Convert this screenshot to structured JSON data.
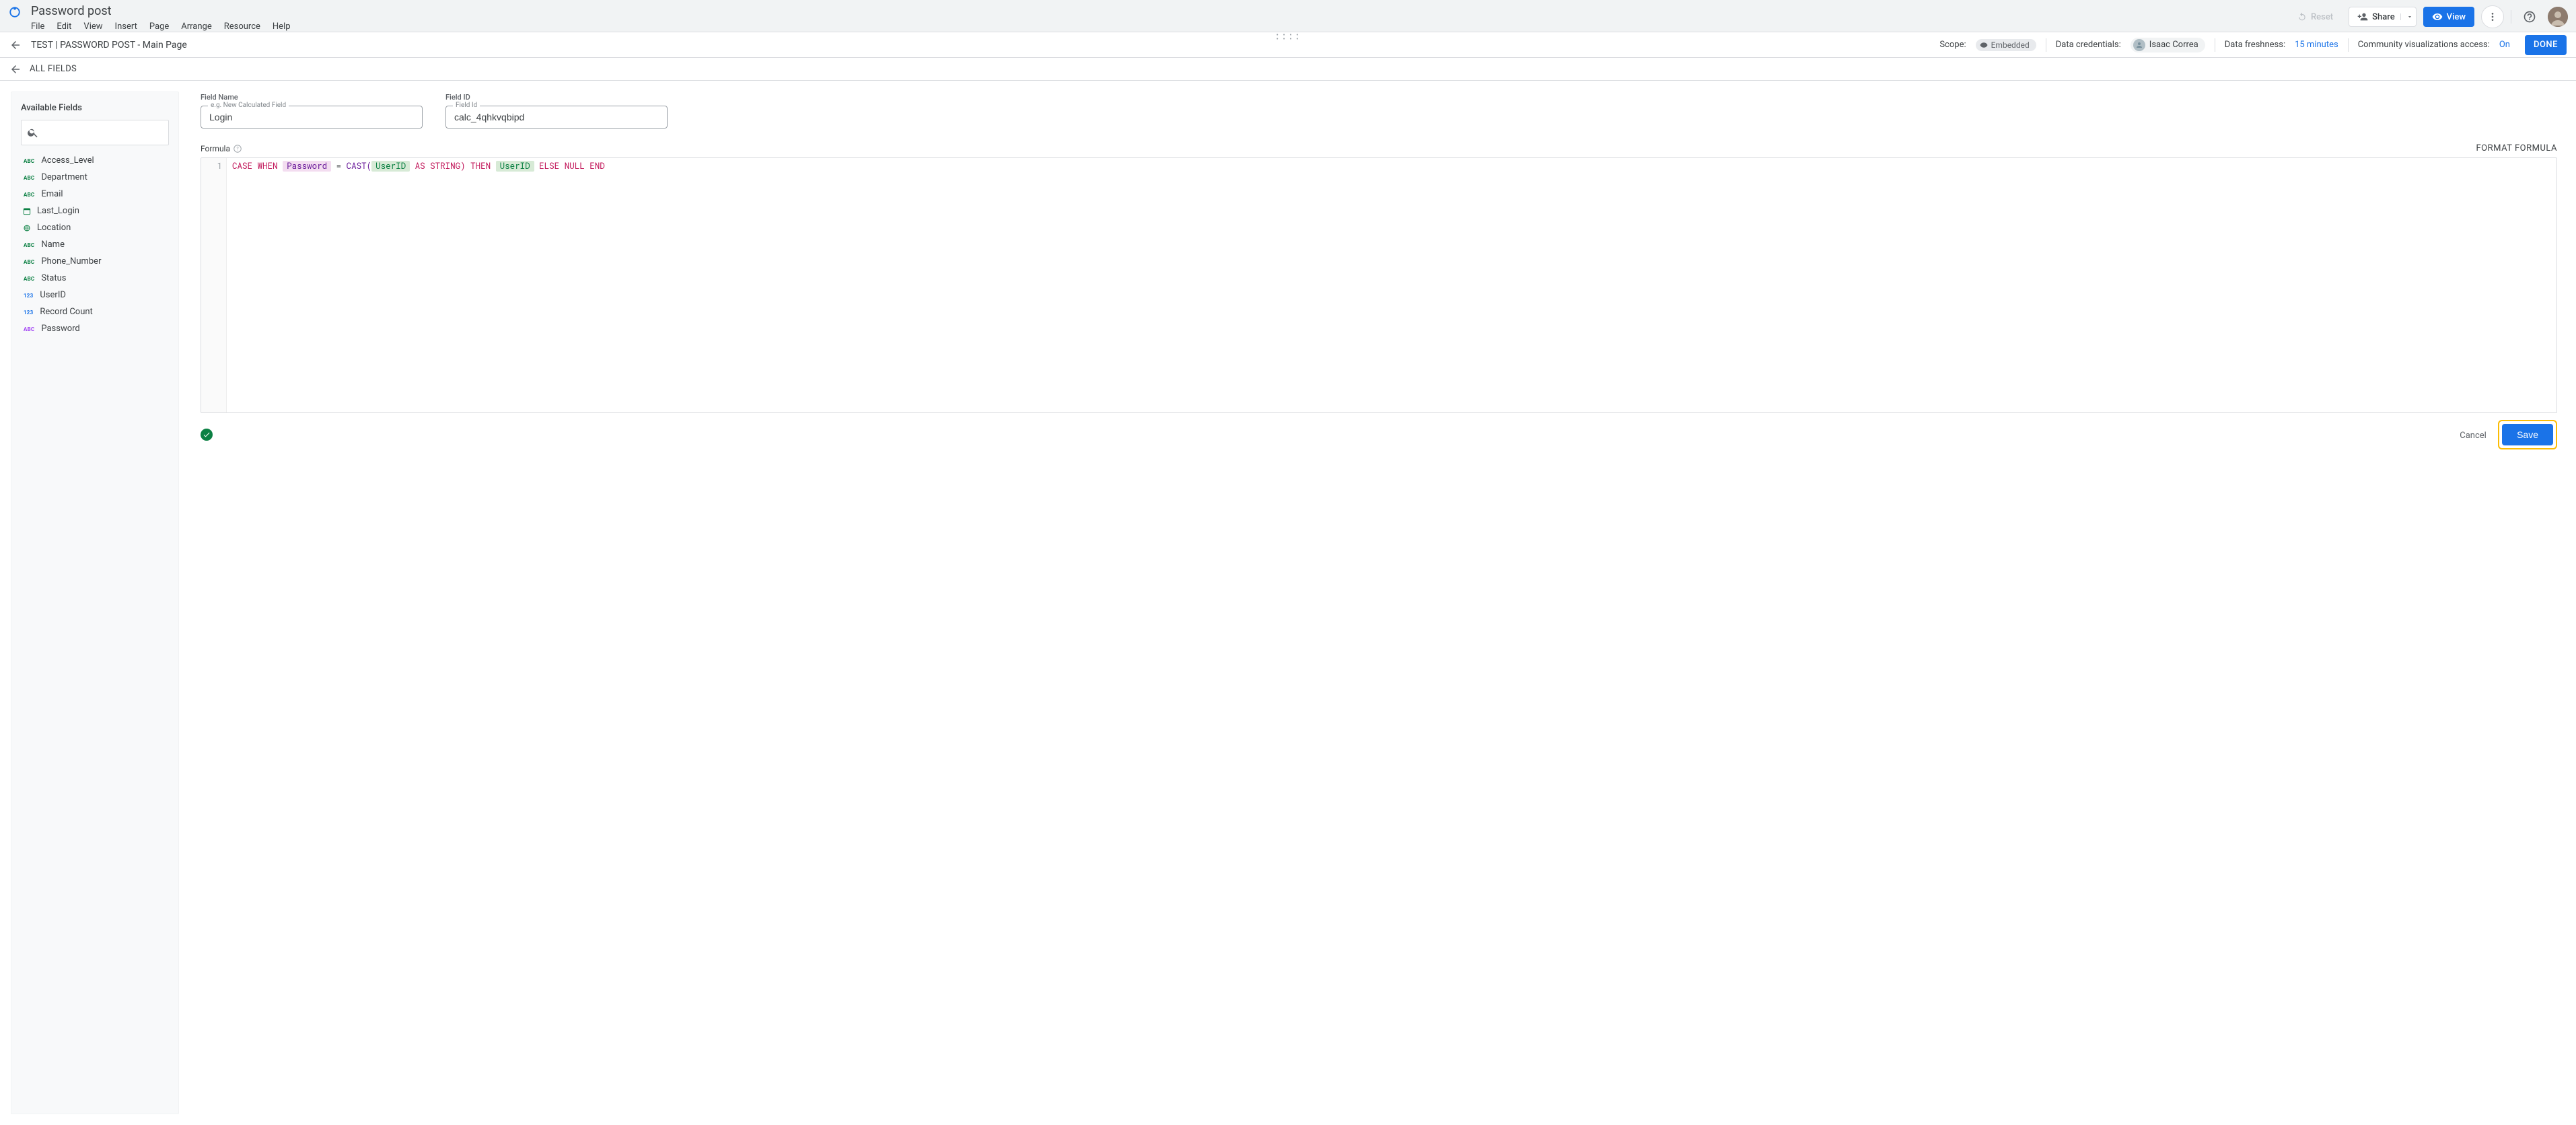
{
  "app": {
    "doc_title": "Password post",
    "menus": [
      "File",
      "Edit",
      "View",
      "Insert",
      "Page",
      "Arrange",
      "Resource",
      "Help"
    ]
  },
  "top_actions": {
    "reset": "Reset",
    "share": "Share",
    "view": "View",
    "done": "DONE"
  },
  "page_bar": {
    "title": "TEST | PASSWORD POST - Main Page",
    "scope_label": "Scope:",
    "scope_value": "Embedded",
    "creds_label": "Data credentials:",
    "creds_user": "Isaac Correa",
    "freshness_label": "Data freshness:",
    "freshness_value": "15 minutes",
    "viz_label": "Community visualizations access:",
    "viz_value": "On"
  },
  "fields_bar": {
    "all_fields": "ALL FIELDS"
  },
  "sidebar": {
    "title": "Available Fields",
    "search_placeholder": "",
    "fields": [
      {
        "name": "Access_Level",
        "type": "abc-g"
      },
      {
        "name": "Department",
        "type": "abc-g"
      },
      {
        "name": "Email",
        "type": "abc-g"
      },
      {
        "name": "Last_Login",
        "type": "date"
      },
      {
        "name": "Location",
        "type": "geo"
      },
      {
        "name": "Name",
        "type": "abc-g"
      },
      {
        "name": "Phone_Number",
        "type": "abc-g"
      },
      {
        "name": "Status",
        "type": "abc-g"
      },
      {
        "name": "UserID",
        "type": "num"
      },
      {
        "name": "Record Count",
        "type": "num"
      },
      {
        "name": "Password",
        "type": "abc-p"
      }
    ]
  },
  "editor": {
    "field_name_label": "Field Name",
    "field_name_float": "e.g. New Calculated Field",
    "field_name_value": "Login",
    "field_id_label": "Field ID",
    "field_id_float": "Field Id",
    "field_id_value": "calc_4qhkvqbipd",
    "formula_label": "Formula",
    "format_btn": "FORMAT FORMULA",
    "line_no": "1",
    "tokens": {
      "case": "CASE",
      "when": "WHEN",
      "password": "Password",
      "eq": " = ",
      "cast_open": "CAST(",
      "userid1": "UserID",
      "as_string": " AS STRING)",
      "then": " THEN ",
      "userid2": "UserID",
      "else": " ELSE ",
      "null": "NULL",
      "end": " END"
    },
    "cancel": "Cancel",
    "save": "Save"
  }
}
